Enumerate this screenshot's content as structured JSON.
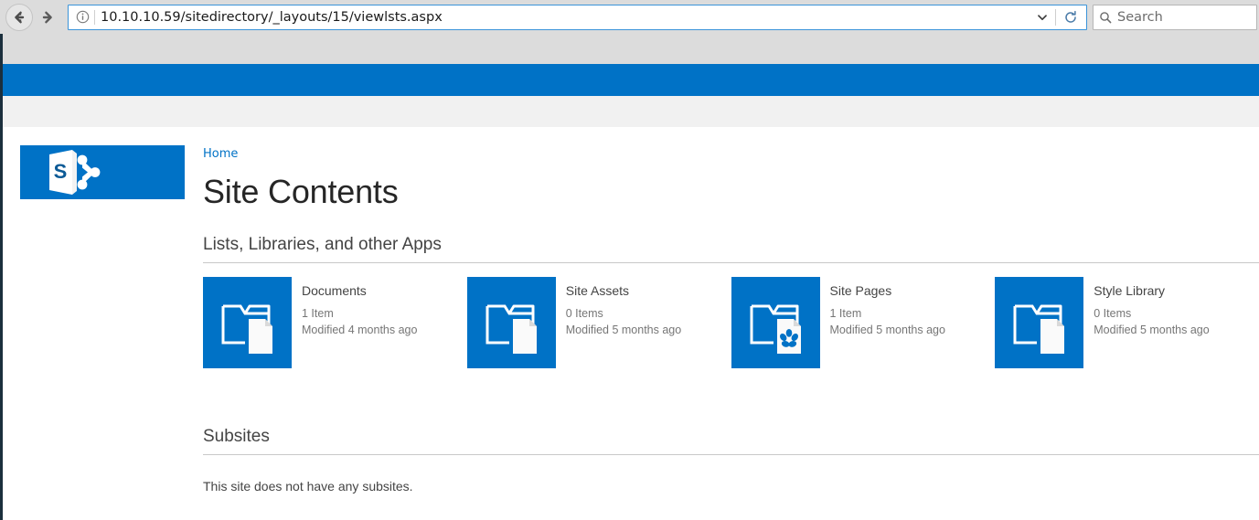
{
  "browser": {
    "back_label": "Back",
    "forward_label": "Forward",
    "url": "10.10.10.59/sitedirectory/_layouts/15/viewlsts.aspx",
    "identity_icon": "info-circle-icon",
    "chevron_icon": "chevron-down-icon",
    "reload_icon": "reload-icon",
    "search_placeholder": "Search",
    "search_value": "",
    "search_icon": "magnifier-icon"
  },
  "theme": {
    "suite_bar_color": "#0072c6",
    "tile_color": "#0072c6",
    "link_color": "#0072c6",
    "chrome_color": "#dcdcdc",
    "sub_bar_color": "#f1f1f1",
    "left_edge_color": "#1b2f3d"
  },
  "logo": {
    "name": "sharepoint-logo",
    "letter": "S"
  },
  "page": {
    "breadcrumb": "Home",
    "title": "Site Contents"
  },
  "apps_section": {
    "heading": "Lists, Libraries, and other Apps",
    "tiles": [
      {
        "title": "Documents",
        "count": "1 Item",
        "modified": "Modified 4 months ago",
        "icon": "folder-document-icon"
      },
      {
        "title": "Site Assets",
        "count": "0 Items",
        "modified": "Modified 5 months ago",
        "icon": "folder-document-icon"
      },
      {
        "title": "Site Pages",
        "count": "1 Item",
        "modified": "Modified 5 months ago",
        "icon": "folder-page-pinwheel-icon"
      },
      {
        "title": "Style Library",
        "count": "0 Items",
        "modified": "Modified 5 months ago",
        "icon": "folder-document-icon"
      }
    ]
  },
  "subsites_section": {
    "heading": "Subsites",
    "empty_message": "This site does not have any subsites."
  }
}
